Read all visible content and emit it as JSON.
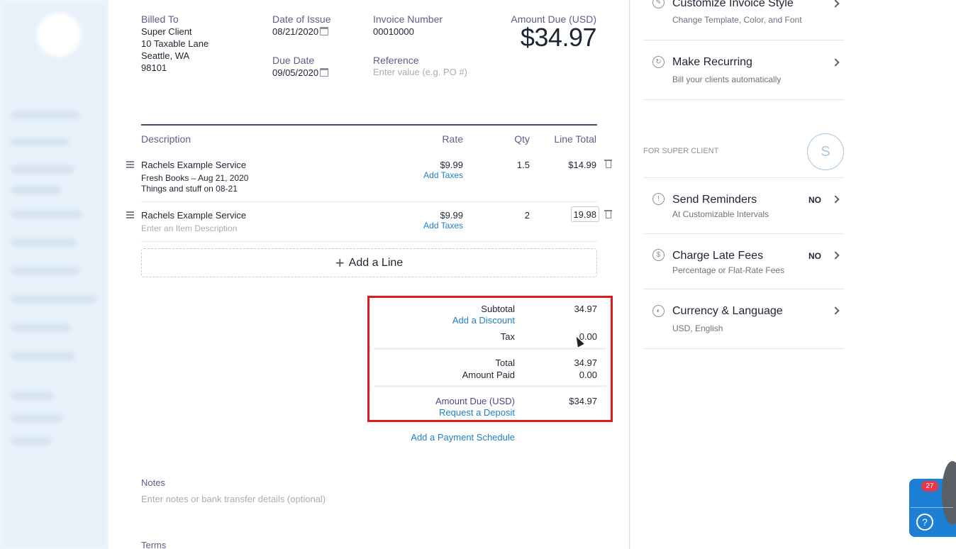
{
  "billing": {
    "billed_to_label": "Billed To",
    "client_name": "Super Client",
    "address_line1": "10 Taxable Lane",
    "address_line2": "Seattle, WA",
    "address_line3": "98101",
    "date_of_issue_label": "Date of Issue",
    "date_of_issue": "08/21/2020",
    "due_date_label": "Due Date",
    "due_date": "09/05/2020",
    "invoice_number_label": "Invoice Number",
    "invoice_number": "00010000",
    "reference_label": "Reference",
    "reference_placeholder": "Enter value (e.g. PO #)",
    "amount_due_label": "Amount Due (USD)",
    "amount_due": "$34.97"
  },
  "table": {
    "headers": [
      "Description",
      "Rate",
      "Qty",
      "Line Total"
    ],
    "rows": [
      {
        "name": "Rachels Example Service",
        "desc1": "Fresh Books – Aug 21, 2020",
        "desc2": "Things and stuff on 08-21",
        "rate": "$9.99",
        "add_taxes": "Add Taxes",
        "qty": "1.5",
        "line_total": "$14.99"
      },
      {
        "name": "Rachels Example Service",
        "desc_placeholder": "Enter an Item Description",
        "rate": "$9.99",
        "add_taxes": "Add Taxes",
        "qty": "2",
        "line_total": "19.98"
      }
    ],
    "add_line_label": "Add a Line"
  },
  "totals": {
    "subtotal_label": "Subtotal",
    "subtotal": "34.97",
    "add_discount": "Add a Discount",
    "tax_label": "Tax",
    "tax": "0.00",
    "total_label": "Total",
    "total": "34.97",
    "amount_paid_label": "Amount Paid",
    "amount_paid": "0.00",
    "amount_due_label": "Amount Due (USD)",
    "amount_due": "$34.97",
    "request_deposit": "Request a Deposit",
    "payment_schedule": "Add a Payment Schedule"
  },
  "notes": {
    "notes_label": "Notes",
    "notes_placeholder": "Enter notes or bank transfer details (optional)",
    "terms_label": "Terms"
  },
  "right_panel": {
    "customize_title": "Customize Invoice Style",
    "customize_sub": "Change Template, Color, and Font",
    "recurring_title": "Make Recurring",
    "recurring_sub": "Bill your clients automatically",
    "for_client_label": "FOR SUPER CLIENT",
    "avatar_letter": "S",
    "reminders_title": "Send Reminders",
    "reminders_sub": "At Customizable Intervals",
    "reminders_status": "NO",
    "late_fees_title": "Charge Late Fees",
    "late_fees_sub": "Percentage or Flat-Rate Fees",
    "late_fees_status": "NO",
    "currency_title": "Currency & Language",
    "currency_sub": "USD, English"
  },
  "chat": {
    "badge_count": "27"
  },
  "colors": {
    "accent_purple": "#4d4780",
    "link_blue": "#1f7fc4",
    "highlight_red": "#e0191f",
    "chat_blue": "#1d7fd4"
  }
}
